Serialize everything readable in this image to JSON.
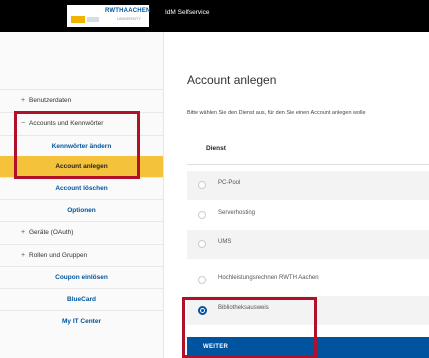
{
  "header": {
    "logo_text": "RWTHAACHEN",
    "logo_sub": "UNIVERSITY",
    "app_title": "IdM Selfservice"
  },
  "sidebar": {
    "items": [
      {
        "label": "Benutzerdaten",
        "prefix": "+"
      },
      {
        "label": "Accounts und Kennwörter",
        "prefix": "−"
      },
      {
        "label": "Kennwörter ändern"
      },
      {
        "label": "Account anlegen"
      },
      {
        "label": "Account löschen"
      },
      {
        "label": "Optionen"
      },
      {
        "label": "Geräte (OAuth)",
        "prefix": "+"
      },
      {
        "label": "Rollen und Gruppen",
        "prefix": "+"
      },
      {
        "label": "Coupon einlösen"
      },
      {
        "label": "BlueCard"
      },
      {
        "label": "My IT Center"
      }
    ]
  },
  "main": {
    "title": "Account anlegen",
    "description": "Bitte wählen Sie den Dienst aus, für den Sie einen Account anlegen wolle",
    "table_header": "Dienst",
    "options": [
      {
        "label": "PC-Pool",
        "selected": false
      },
      {
        "label": "Serverhosting",
        "selected": false
      },
      {
        "label": "UMS",
        "selected": false
      },
      {
        "label": "Hochleistungsrechnen RWTH Aachen",
        "selected": false
      },
      {
        "label": "Bibliotheksausweis",
        "selected": true
      }
    ],
    "button_label": "WEITER"
  },
  "colors": {
    "accent": "#00549f",
    "active_nav": "#f5c33b",
    "highlight_box": "#b0102a"
  }
}
